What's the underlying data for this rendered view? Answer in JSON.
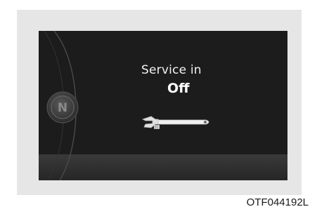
{
  "display": {
    "message_line1": "Service in",
    "message_line2": "Off",
    "gear_letter": "N",
    "icon": "wrench-icon"
  },
  "caption": "OTF044192L",
  "colors": {
    "screen_background": "#1c1c1c",
    "panel_background": "#e6e6e6",
    "text": "#f2f2f2"
  }
}
